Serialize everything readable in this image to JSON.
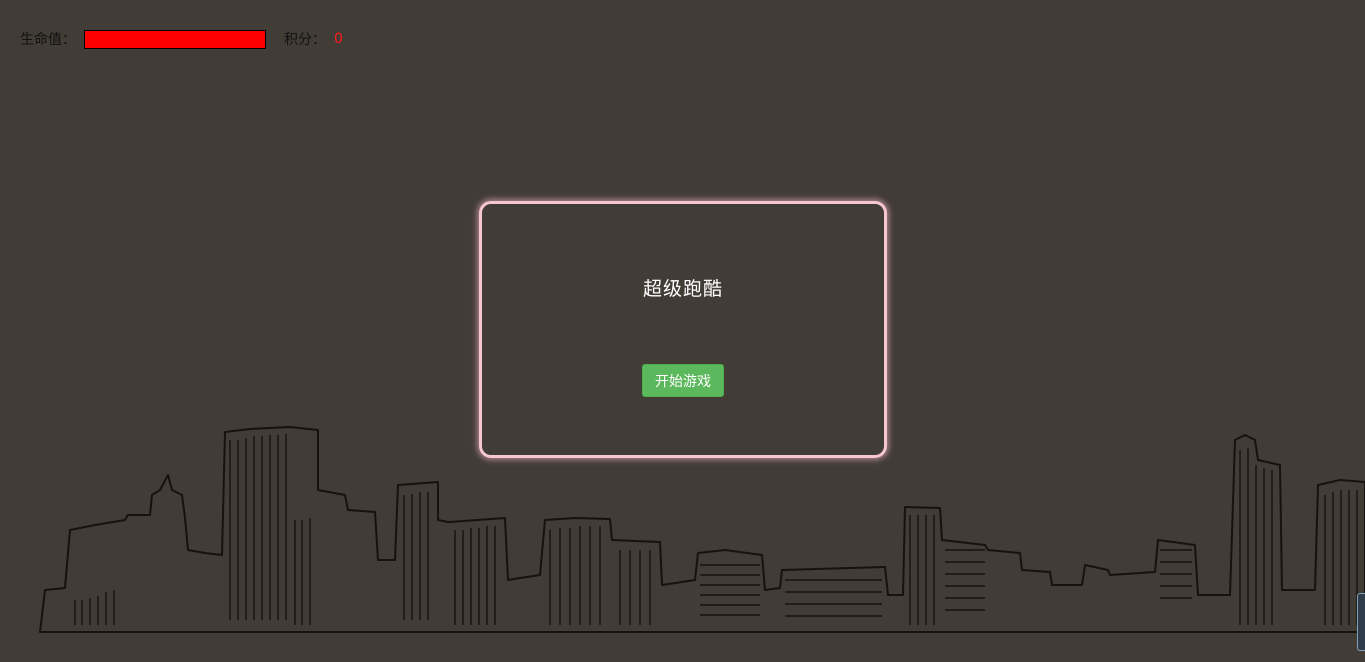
{
  "hud": {
    "hp_label": "生命值：",
    "hp_level": 1.0,
    "score_label": "积分：",
    "score_value": "0"
  },
  "dialog": {
    "title": "超级跑酷",
    "start_button_label": "开始游戏"
  },
  "colors": {
    "background": "#423c37",
    "hp_bar": "#ff0000",
    "score_value": "#ff1a1a",
    "dialog_border": "#f6c7cf",
    "start_button": "#5cb85c",
    "skyline_ink": "#15120f"
  },
  "icons": {
    "side_tab": "side-panel-tab-icon"
  }
}
